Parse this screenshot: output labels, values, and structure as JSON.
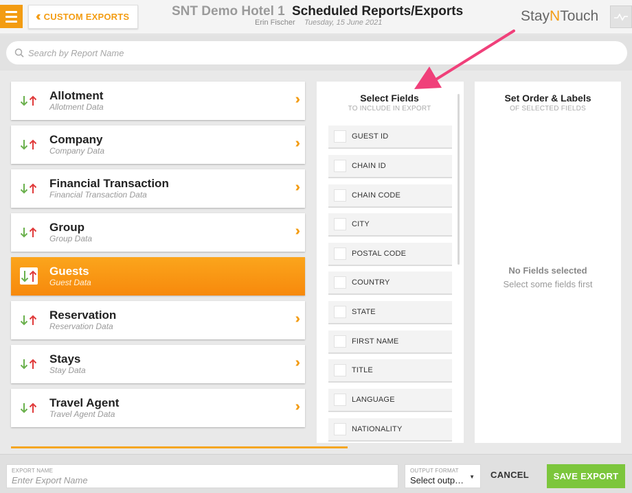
{
  "header": {
    "back_label": "CUSTOM EXPORTS",
    "hotel_name": "SNT Demo Hotel 1",
    "page_title": "Scheduled Reports/Exports",
    "user_name": "Erin Fischer",
    "date": "Tuesday, 15 June 2021",
    "logo_prefix": "Stay",
    "logo_mid": "N",
    "logo_suffix": "Touch"
  },
  "search": {
    "placeholder": "Search by Report Name"
  },
  "reports": [
    {
      "name": "Allotment",
      "sub": "Allotment Data",
      "active": false
    },
    {
      "name": "Company",
      "sub": "Company Data",
      "active": false
    },
    {
      "name": "Financial Transaction",
      "sub": "Financial Transaction Data",
      "active": false
    },
    {
      "name": "Group",
      "sub": "Group Data",
      "active": false
    },
    {
      "name": "Guests",
      "sub": "Guest Data",
      "active": true
    },
    {
      "name": "Reservation",
      "sub": "Reservation Data",
      "active": false
    },
    {
      "name": "Stays",
      "sub": "Stay Data",
      "active": false
    },
    {
      "name": "Travel Agent",
      "sub": "Travel Agent Data",
      "active": false
    }
  ],
  "select_fields": {
    "title": "Select Fields",
    "subtitle": "TO INCLUDE IN EXPORT",
    "fields": [
      {
        "label": "GUEST ID",
        "checked": false
      },
      {
        "label": "CHAIN ID",
        "checked": false
      },
      {
        "label": "CHAIN CODE",
        "checked": false
      },
      {
        "label": "CITY",
        "checked": false
      },
      {
        "label": "POSTAL CODE",
        "checked": false
      },
      {
        "label": "COUNTRY",
        "checked": false
      },
      {
        "label": "STATE",
        "checked": false
      },
      {
        "label": "FIRST NAME",
        "checked": false
      },
      {
        "label": "TITLE",
        "checked": false
      },
      {
        "label": "LANGUAGE",
        "checked": false
      },
      {
        "label": "NATIONALITY",
        "checked": false
      }
    ]
  },
  "order_labels": {
    "title": "Set Order & Labels",
    "subtitle": "OF SELECTED FIELDS",
    "empty_title": "No Fields selected",
    "empty_sub": "Select some fields first"
  },
  "footer": {
    "export_name_caption": "EXPORT NAME",
    "export_name_placeholder": "Enter Export Name",
    "export_name_value": "",
    "output_caption": "OUTPUT FORMAT",
    "output_value": "Select output format",
    "cancel_label": "CANCEL",
    "save_label": "SAVE EXPORT"
  },
  "colors": {
    "accent": "#f39c12",
    "save_green": "#7cc63c",
    "annotation_arrow": "#f0407a",
    "icon_down": "#6ab04c",
    "icon_up": "#e03a3a"
  }
}
